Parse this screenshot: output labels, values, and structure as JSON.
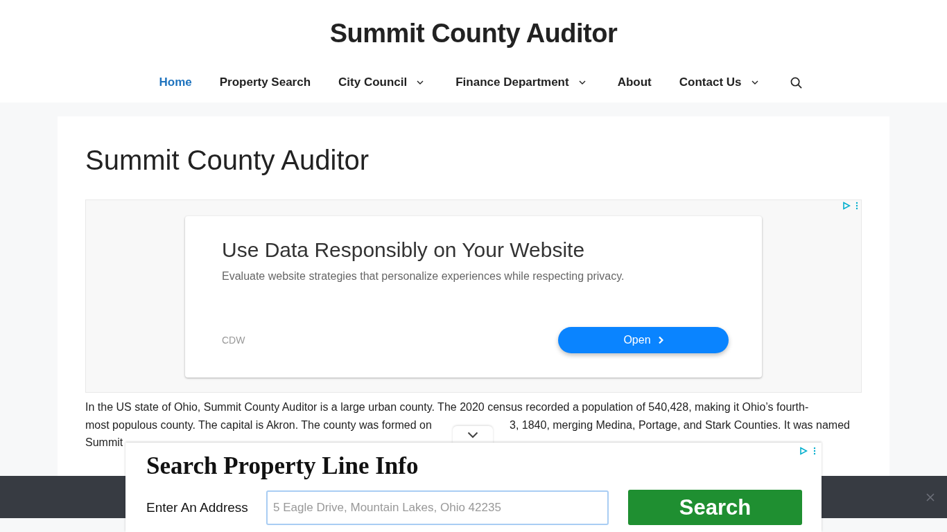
{
  "site_title": "Summit County Auditor",
  "nav": {
    "items": [
      {
        "label": "Home",
        "selected": true,
        "dropdown": false
      },
      {
        "label": "Property Search",
        "selected": false,
        "dropdown": false
      },
      {
        "label": "City Council",
        "selected": false,
        "dropdown": true
      },
      {
        "label": "Finance Department",
        "selected": false,
        "dropdown": true
      },
      {
        "label": "About",
        "selected": false,
        "dropdown": false
      },
      {
        "label": "Contact Us",
        "selected": false,
        "dropdown": true
      }
    ]
  },
  "page_title": "Summit County Auditor",
  "ad": {
    "headline": "Use Data Responsibly on Your Website",
    "description": "Evaluate website strategies that personalize experiences while respecting privacy.",
    "advertiser": "CDW",
    "button": "Open"
  },
  "paragraph": [
    "In the US state of Ohio, Summit County Auditor is a large urban county. The 2020 census recorded a population of 540,428, making it Ohio’s fourth-",
    "most populous county. The capital is Akron. The county was formed on",
    "3, 1840, merging Medina, Portage, and Stark Counties. It was named",
    "Summit"
  ],
  "bottom_ad": {
    "title": "Search Property Line Info",
    "label": "Enter An Address",
    "placeholder": "5 Eagle Drive, Mountain Lakes, Ohio 42235",
    "button": "Search"
  }
}
